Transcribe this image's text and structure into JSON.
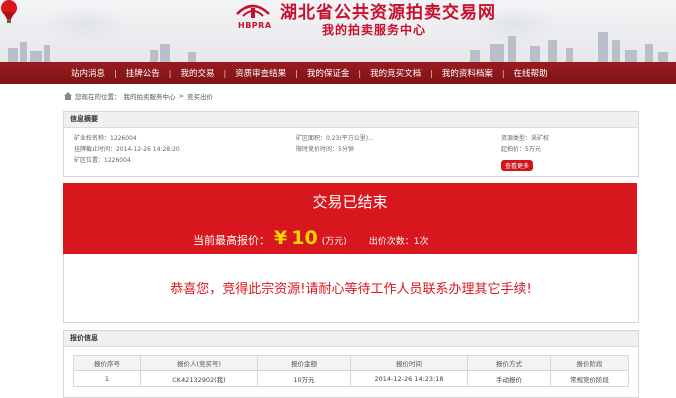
{
  "header": {
    "logo_text": "HBPRA",
    "site_title": "湖北省公共资源拍卖交易网",
    "site_subtitle": "我的拍卖服务中心"
  },
  "nav": {
    "items": [
      "站内消息",
      "挂牌公告",
      "我的交易",
      "资质审查结果",
      "我的保证金",
      "我的竞买文档",
      "我的资料档案",
      "在线帮助"
    ]
  },
  "breadcrumb": {
    "prefix": "您现在的位置：",
    "path1": "我的拍卖服务中心",
    "sep": " > ",
    "path2": "竞买出价"
  },
  "info": {
    "title": "信息摘要",
    "fields": [
      {
        "label": "矿业权名称：",
        "value": "1226004"
      },
      {
        "label": "矿区面积：",
        "value": "0.23(平方公里)..."
      },
      {
        "label": "资源类型：",
        "value": "采矿权"
      },
      {
        "label": "挂牌截止时间：",
        "value": "2014-12-26 14:28:20"
      },
      {
        "label": "限时竞价时间：",
        "value": "5分钟"
      },
      {
        "label": "起拍价：",
        "value": "5万元"
      },
      {
        "label": "矿区位置：",
        "value": "1226004"
      }
    ],
    "more_button": "查看更多"
  },
  "auction": {
    "status": "交易已结束",
    "price_label": "当前最高报价：",
    "currency": "¥",
    "price": "10",
    "unit": "(万元)",
    "bid_count": "出价次数：1次"
  },
  "congrats": "恭喜您，竞得此宗资源!请耐心等待工作人员联系办理其它手续!",
  "bids": {
    "title": "报价信息",
    "columns": [
      "报价序号",
      "报价人(竞买号)",
      "报价金额",
      "报价时间",
      "报价方式",
      "报价阶段"
    ],
    "rows": [
      [
        "1",
        "CK42132902(我)",
        "10万元",
        "2014-12-26 14:23:18",
        "手动报价",
        "常规竞价阶段"
      ]
    ]
  },
  "colors": {
    "brand_red": "#d7161d",
    "nav_red": "#8b1719",
    "price_yellow": "#f9d300"
  }
}
